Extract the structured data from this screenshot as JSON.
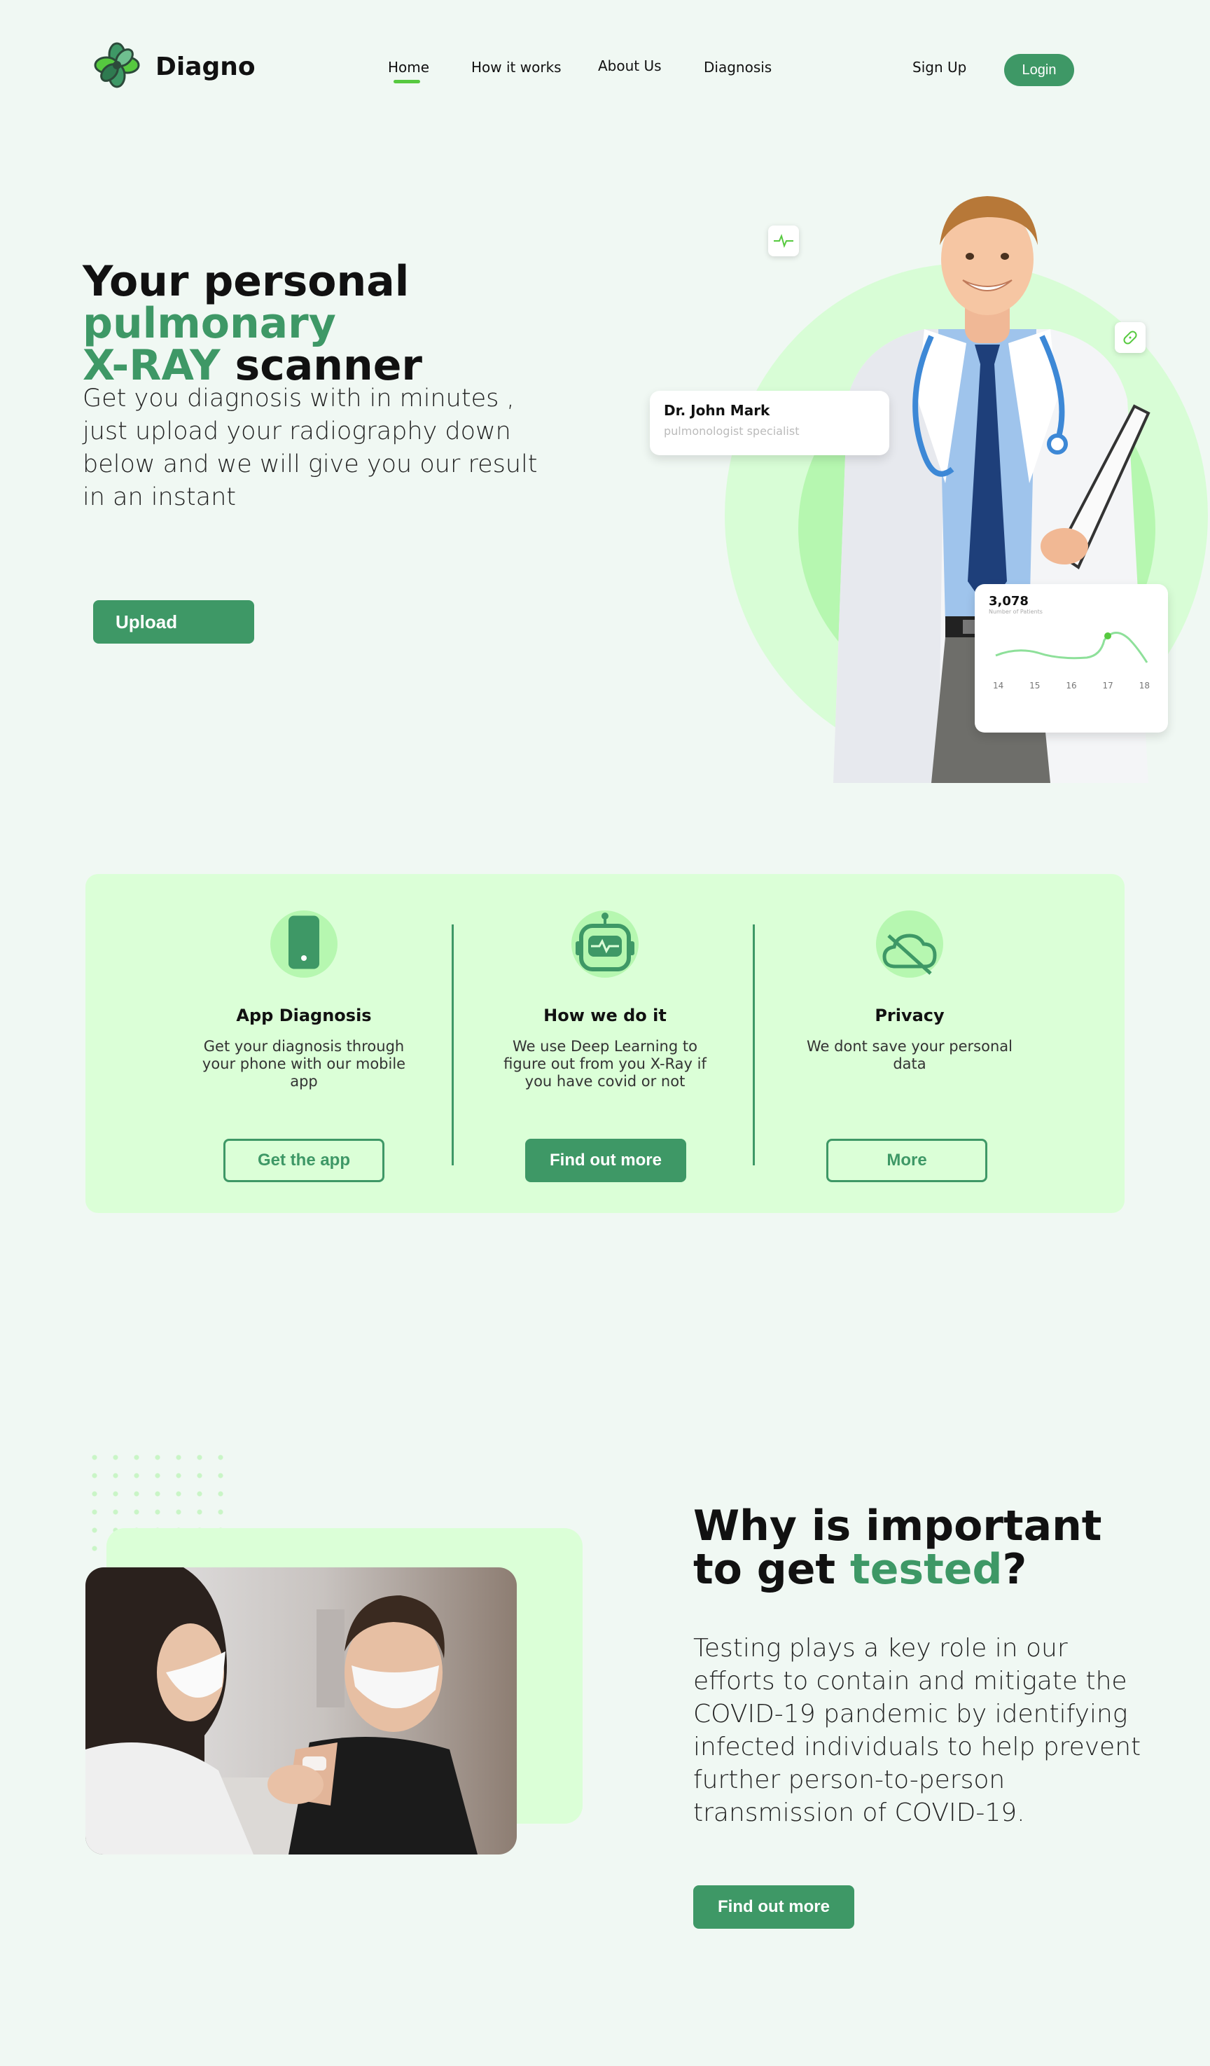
{
  "brand": {
    "name": "Diagno",
    "icon": "clover-logo-icon"
  },
  "nav": {
    "items": [
      {
        "label": "Home",
        "active": true
      },
      {
        "label": "How it works"
      },
      {
        "label": "About Us"
      },
      {
        "label": "Diagnosis"
      }
    ],
    "signup_label": "Sign Up",
    "login_label": "Login"
  },
  "hero": {
    "title_part1": "Your personal ",
    "title_highlight1": "pulmonary",
    "title_highlight2": "X-RAY",
    "title_part2": " scanner",
    "description": "Get you diagnosis with in minutes , just upload your radiography down below and we will give you our result in an instant",
    "upload_label": "Upload",
    "doctor_card": {
      "name": "Dr. John Mark",
      "role": "pulmonologist specialist"
    },
    "stat_card": {
      "value": "3,078",
      "label": "Number of Patients",
      "days": [
        "14",
        "15",
        "16",
        "17",
        "18"
      ]
    },
    "icons": [
      "heartbeat-icon",
      "bandage-icon"
    ]
  },
  "features": [
    {
      "icon": "smartphone-icon",
      "title": "App Diagnosis",
      "description": "Get your diagnosis through your phone with our mobile app",
      "button": "Get the app",
      "button_style": "outline"
    },
    {
      "icon": "robot-icon",
      "title": "How we do it",
      "description": "We use Deep Learning to figure out from you X-Ray if you have covid or not",
      "button": "Find out more",
      "button_style": "solid"
    },
    {
      "icon": "cloud-off-icon",
      "title": "Privacy",
      "description": "We dont save your personal data",
      "button": "More",
      "button_style": "outline"
    }
  ],
  "why": {
    "title_part1": "Why is important to get ",
    "title_highlight": "tested",
    "title_part2": "?",
    "description": "Testing plays a key role in our efforts to contain and mitigate the COVID-19 pandemic by identifying infected individuals to help prevent further person-to-person transmission of COVID-19.",
    "button": "Find out more"
  },
  "colors": {
    "primary": "#3e9866",
    "accent": "#56c93f",
    "light": "#dbffd7",
    "background": "#f0f8f3"
  }
}
